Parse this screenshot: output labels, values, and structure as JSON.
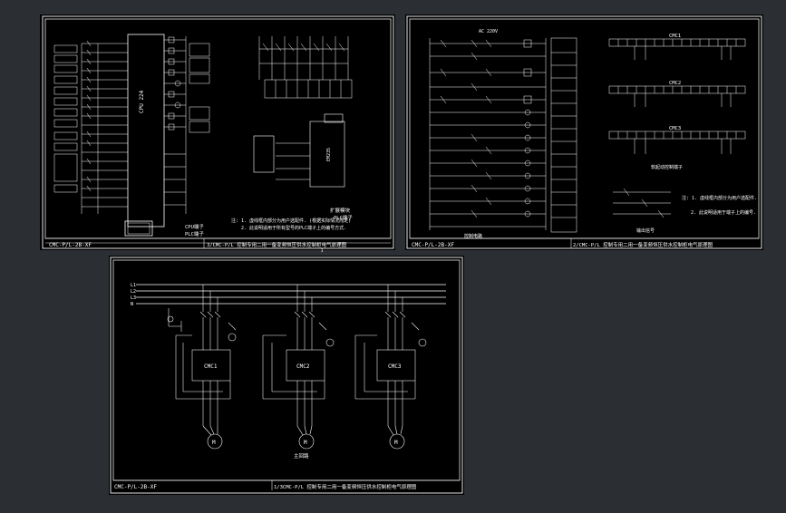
{
  "colors": {
    "background": "#000000",
    "frame": "#2b2e33",
    "border": "#e6e6e6",
    "line": "#ffffff",
    "text": "#ffffff"
  },
  "sheet1": {
    "cpu_label": "CPU 224",
    "note1": "注: 1. 虚线框内部分为用户选配件. (根据实际情况而定)",
    "note2": "2. 此说明适用于所有型号的PLC端子上的编号方式.",
    "caption_cpu": "CPU端子",
    "caption_plc": "PLC端子",
    "caption_ext": "扩展模块",
    "caption_ext_plc": "PLC端子",
    "module_label": "EM235",
    "title_code": "CMC-P/L-2B-XF",
    "title_desc": "3/CMC-P/L 控制专用二用一备变频恒压供水控制柜电气原理图",
    "sheet_no": "3"
  },
  "sheet2": {
    "ac_label": "AC 220V",
    "title_code": "CMC-P/L-2B-XF",
    "title_desc": "2/CMC-P/L 控制专用二用一备变频恒压供水控制柜电气原理图",
    "cmc1": "CMC1",
    "cmc2": "CMC2",
    "cmc3": "CMC3",
    "ctrl_caption": "控制电路",
    "soft_caption": "软起动控制端子",
    "note1": "注: 1. 虚线框内部分为用户选配件.",
    "note2": "2. 此说明适用于端子上的编号.",
    "sig_caption": "输出信号",
    "sheet_no": "2"
  },
  "sheet3": {
    "bus_labels": [
      "L1",
      "L2",
      "L3",
      "N"
    ],
    "softstarters": [
      "CMC1",
      "CMC2",
      "CMC3"
    ],
    "motors": [
      "M",
      "M",
      "M"
    ],
    "main_caption": "主回路",
    "title_code": "CMC-P/L-2B-XF",
    "title_desc": "1/3CMC-P/L 控制专用二用一备变频恒压供水控制柜电气原理图",
    "sheet_no": "1"
  }
}
